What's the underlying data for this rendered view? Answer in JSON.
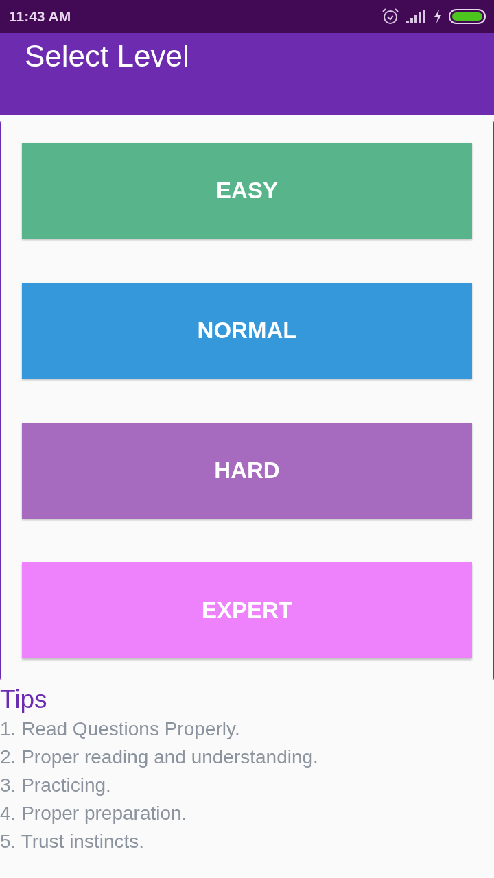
{
  "status_bar": {
    "time": "11:43 AM"
  },
  "app_bar": {
    "title": "Select Level"
  },
  "levels": [
    {
      "label": "EASY",
      "color": "#57b48b"
    },
    {
      "label": "NORMAL",
      "color": "#3598db"
    },
    {
      "label": "HARD",
      "color": "#a66bbe"
    },
    {
      "label": "EXPERT",
      "color": "#ee82fd"
    }
  ],
  "tips": {
    "title": "Tips",
    "items": [
      "1. Read Questions Properly.",
      "2. Proper reading and understanding.",
      "3. Practicing.",
      "4. Proper preparation.",
      "5. Trust instincts."
    ]
  }
}
